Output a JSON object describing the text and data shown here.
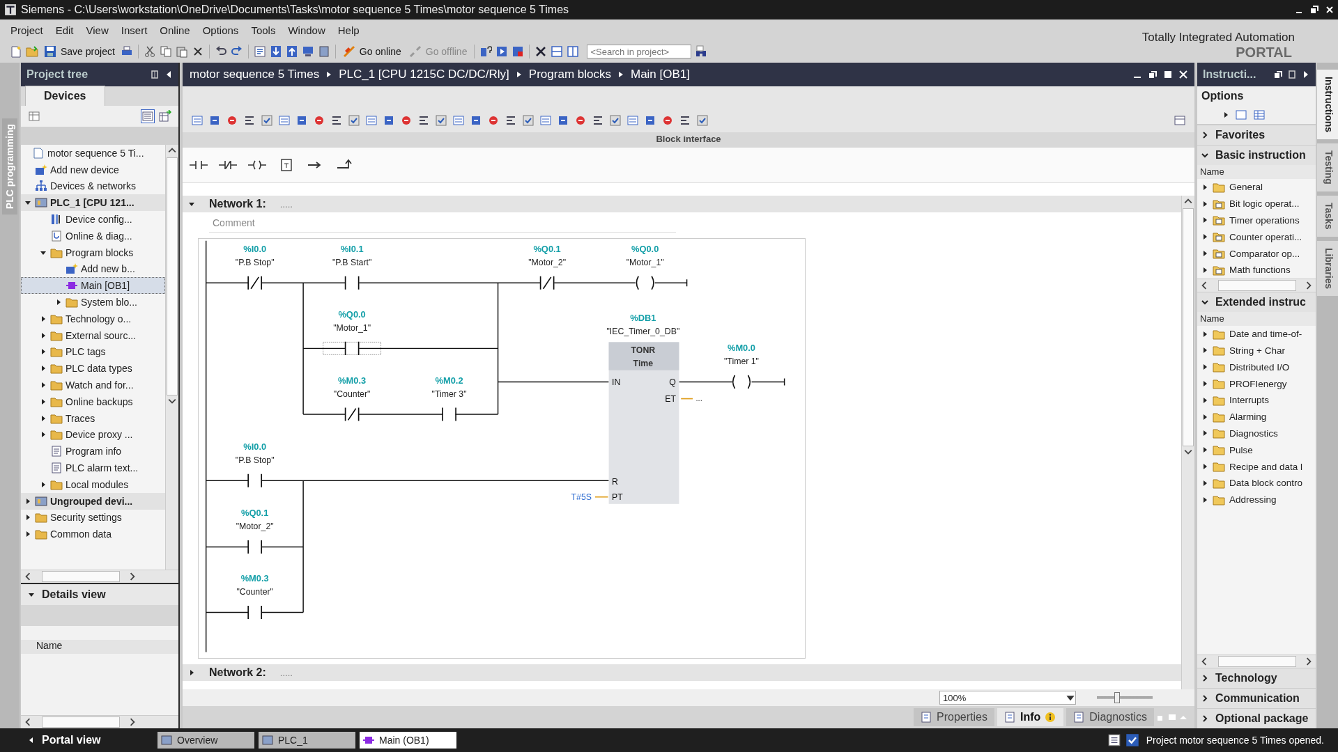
{
  "window": {
    "title": "Siemens  -  C:\\Users\\workstation\\OneDrive\\Documents\\Tasks\\motor sequence 5 Times\\motor sequence 5 Times"
  },
  "menu": [
    "Project",
    "Edit",
    "View",
    "Insert",
    "Online",
    "Options",
    "Tools",
    "Window",
    "Help"
  ],
  "toolbar": {
    "buttons": [
      {
        "label": "Save project",
        "disabled": false
      },
      {
        "label": "Go online",
        "disabled": false
      },
      {
        "label": "Go offline",
        "disabled": true
      }
    ],
    "search_placeholder": "<Search in project>"
  },
  "branding": {
    "line1": "Totally Integrated Automation",
    "line2": "PORTAL"
  },
  "side_tab": "PLC programming",
  "project_tree": {
    "title": "Project tree",
    "tab": "Devices",
    "items": [
      {
        "label": "motor sequence 5 Ti...",
        "kind": "project",
        "expandable": false,
        "selected": false,
        "children": [
          {
            "label": "Add new device",
            "kind": "add",
            "expandable": false,
            "selected": false
          },
          {
            "label": "Devices & networks",
            "kind": "network",
            "expandable": false,
            "selected": false
          },
          {
            "label": "PLC_1 [CPU 121...",
            "kind": "plc",
            "expandable": true,
            "expanded": true,
            "selected": false,
            "children": [
              {
                "label": "Device config...",
                "kind": "config",
                "expandable": false,
                "selected": false
              },
              {
                "label": "Online & diag...",
                "kind": "diag",
                "expandable": false,
                "selected": false
              },
              {
                "label": "Program blocks",
                "kind": "folder",
                "expandable": true,
                "expanded": true,
                "selected": false,
                "children": [
                  {
                    "label": "Add new b...",
                    "kind": "add",
                    "expandable": false,
                    "selected": false
                  },
                  {
                    "label": "Main [OB1]",
                    "kind": "block",
                    "expandable": false,
                    "selected": true
                  },
                  {
                    "label": "System blo...",
                    "kind": "folder",
                    "expandable": true,
                    "expanded": false,
                    "selected": false
                  }
                ]
              },
              {
                "label": "Technology o...",
                "kind": "folder",
                "expandable": true,
                "expanded": false,
                "selected": false
              },
              {
                "label": "External sourc...",
                "kind": "folder",
                "expandable": true,
                "expanded": false,
                "selected": false
              },
              {
                "label": "PLC tags",
                "kind": "folder",
                "expandable": true,
                "expanded": false,
                "selected": false
              },
              {
                "label": "PLC data types",
                "kind": "folder",
                "expandable": true,
                "expanded": false,
                "selected": false
              },
              {
                "label": "Watch and for...",
                "kind": "folder",
                "expandable": true,
                "expanded": false,
                "selected": false
              },
              {
                "label": "Online backups",
                "kind": "folder",
                "expandable": true,
                "expanded": false,
                "selected": false
              },
              {
                "label": "Traces",
                "kind": "folder",
                "expandable": true,
                "expanded": false,
                "selected": false
              },
              {
                "label": "Device proxy ...",
                "kind": "folder",
                "expandable": true,
                "expanded": false,
                "selected": false
              },
              {
                "label": "Program info",
                "kind": "document",
                "expandable": false,
                "selected": false
              },
              {
                "label": "PLC alarm text...",
                "kind": "document",
                "expandable": false,
                "selected": false
              },
              {
                "label": "Local modules",
                "kind": "folder",
                "expandable": true,
                "expanded": false,
                "selected": false
              }
            ]
          },
          {
            "label": "Ungrouped devi...",
            "kind": "plc",
            "expandable": true,
            "expanded": false,
            "selected": false
          },
          {
            "label": "Security settings",
            "kind": "folder",
            "expandable": true,
            "expanded": false,
            "selected": false
          },
          {
            "label": "Common data",
            "kind": "folder",
            "expandable": true,
            "expanded": false,
            "selected": false
          }
        ]
      }
    ]
  },
  "details_view": {
    "title": "Details view",
    "column": "Name"
  },
  "editor": {
    "breadcrumb": [
      "motor sequence 5 Times",
      "PLC_1 [CPU 1215C DC/DC/Rly]",
      "Program blocks",
      "Main [OB1]"
    ],
    "block_interface": "Block interface",
    "networks": [
      {
        "title": "Network 1:",
        "title_placeholder": ".....",
        "expanded": true,
        "comment": "Comment"
      },
      {
        "title": "Network 2:",
        "title_placeholder": ".....",
        "expanded": false
      }
    ],
    "zoom": "100%",
    "zoom_slider": {
      "level": 0.35
    }
  },
  "ladder": {
    "elements": [
      {
        "kind": "contact_nc",
        "address": "%I0.0",
        "tag": "\"P.B Stop\"",
        "selected": false
      },
      {
        "kind": "contact_no",
        "address": "%I0.1",
        "tag": "\"P.B Start\"",
        "selected": false
      },
      {
        "kind": "contact_no",
        "address": "%Q0.0",
        "tag": "\"Motor_1\"",
        "selected": true
      },
      {
        "kind": "contact_nc",
        "address": "%M0.3",
        "tag": "\"Counter\"",
        "selected": false
      },
      {
        "kind": "contact_no",
        "address": "%M0.2",
        "tag": "\"Timer 3\"",
        "selected": false
      },
      {
        "kind": "contact_nc",
        "address": "%Q0.1",
        "tag": "\"Motor_2\"",
        "selected": false
      },
      {
        "kind": "coil",
        "address": "%Q0.0",
        "tag": "\"Motor_1\"",
        "selected": false
      },
      {
        "kind": "coil",
        "address": "%M0.0",
        "tag": "\"Timer 1\"",
        "selected": false
      },
      {
        "kind": "contact_no",
        "address": "%I0.0",
        "tag": "\"P.B Stop\"",
        "selected": false
      },
      {
        "kind": "contact_no",
        "address": "%Q0.1",
        "tag": "\"Motor_2\"",
        "selected": false
      },
      {
        "kind": "contact_no",
        "address": "%M0.3",
        "tag": "\"Counter\"",
        "selected": false
      }
    ],
    "timer": {
      "instance": "%DB1",
      "instance_name": "\"IEC_Timer_0_DB\"",
      "type": "TONR",
      "subtype": "Time",
      "inputs": [
        "IN",
        "R",
        "PT"
      ],
      "outputs": [
        "Q",
        "ET"
      ],
      "pt_value": "T#5S",
      "et_value": "..."
    }
  },
  "instructions": {
    "title": "Instructi...",
    "options": "Options",
    "sections": [
      {
        "title": "Favorites",
        "expanded": false
      },
      {
        "title": "Basic instruction",
        "expanded": true,
        "column": "Name",
        "items": [
          {
            "label": "General",
            "kind": "plain"
          },
          {
            "label": "Bit logic operat...",
            "kind": "labeled"
          },
          {
            "label": "Timer operations",
            "kind": "labeled"
          },
          {
            "label": "Counter operati...",
            "kind": "labeled"
          },
          {
            "label": "Comparator op...",
            "kind": "labeled"
          },
          {
            "label": "Math functions",
            "kind": "labeled"
          }
        ]
      },
      {
        "title": "Extended instruc",
        "expanded": true,
        "column": "Name",
        "items": [
          {
            "label": "Date and time-of-",
            "kind": "plain"
          },
          {
            "label": "String + Char",
            "kind": "plain"
          },
          {
            "label": "Distributed I/O",
            "kind": "plain"
          },
          {
            "label": "PROFIenergy",
            "kind": "plain"
          },
          {
            "label": "Interrupts",
            "kind": "plain"
          },
          {
            "label": "Alarming",
            "kind": "plain"
          },
          {
            "label": "Diagnostics",
            "kind": "plain"
          },
          {
            "label": "Pulse",
            "kind": "plain"
          },
          {
            "label": "Recipe and data l",
            "kind": "plain"
          },
          {
            "label": "Data block contro",
            "kind": "plain"
          },
          {
            "label": "Addressing",
            "kind": "plain"
          }
        ]
      },
      {
        "title": "Technology",
        "expanded": false
      },
      {
        "title": "Communication",
        "expanded": false
      },
      {
        "title": "Optional package",
        "expanded": false
      }
    ]
  },
  "task_cards": [
    {
      "label": "Instructions",
      "selected": true
    },
    {
      "label": "Testing",
      "selected": false
    },
    {
      "label": "Tasks",
      "selected": false
    },
    {
      "label": "Libraries",
      "selected": false
    }
  ],
  "inspector_tabs": [
    {
      "label": "Properties",
      "selected": false
    },
    {
      "label": "Info",
      "selected": true
    },
    {
      "label": "Diagnostics",
      "selected": false
    }
  ],
  "taskbar": {
    "portal_view": "Portal view",
    "tabs": [
      {
        "label": "Overview",
        "selected": false
      },
      {
        "label": "PLC_1",
        "selected": false
      },
      {
        "label": "Main (OB1)",
        "selected": true
      }
    ],
    "status": "Project motor sequence 5 Times opened."
  }
}
